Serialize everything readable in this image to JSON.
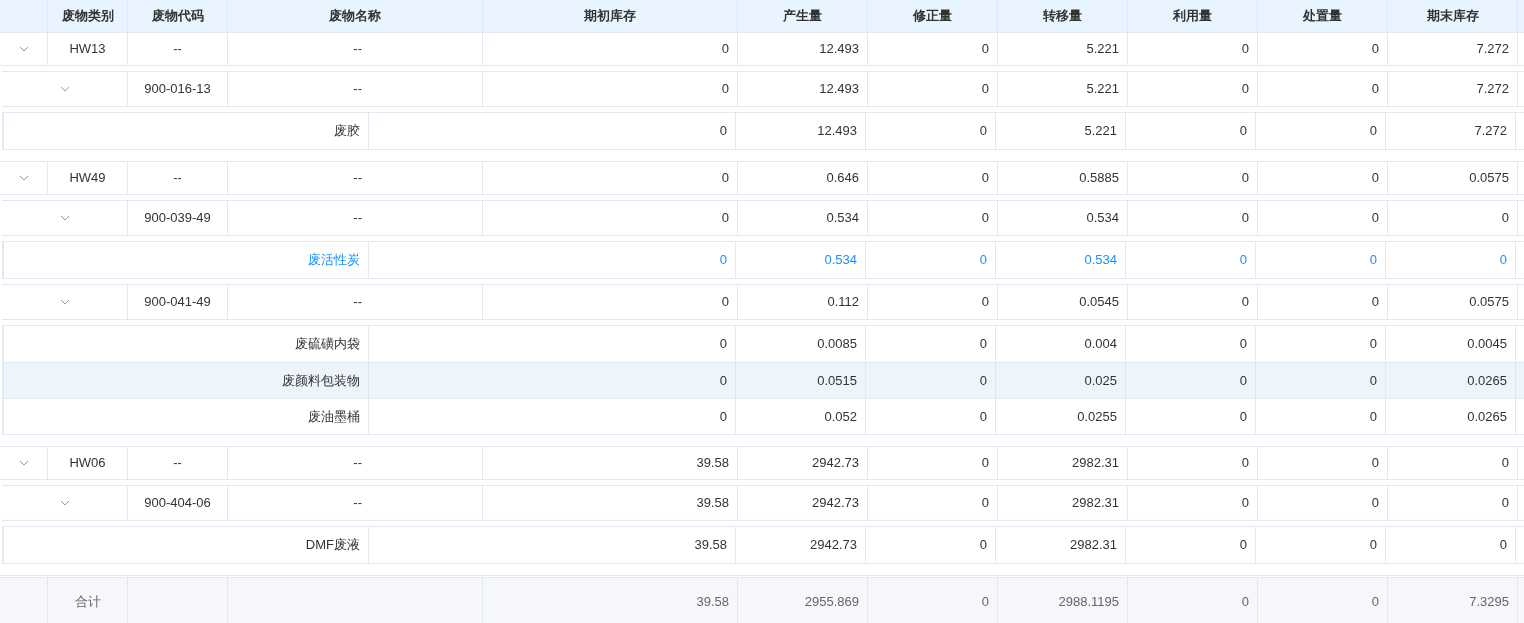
{
  "columns": [
    "废物类别",
    "废物代码",
    "废物名称",
    "期初库存",
    "产生量",
    "修正量",
    "转移量",
    "利用量",
    "处置量",
    "期末库存"
  ],
  "categories": [
    {
      "type": "HW13",
      "code": "--",
      "name": "--",
      "expanded": true,
      "values": [
        "0",
        "12.493",
        "0",
        "5.221",
        "0",
        "0",
        "7.272"
      ],
      "children": [
        {
          "code": "900-016-13",
          "name": "--",
          "expanded": true,
          "values": [
            "0",
            "12.493",
            "0",
            "5.221",
            "0",
            "0",
            "7.272"
          ],
          "children": [
            {
              "name": "废胶",
              "selected": false,
              "hovered": false,
              "values": [
                "0",
                "12.493",
                "0",
                "5.221",
                "0",
                "0",
                "7.272"
              ]
            }
          ]
        }
      ]
    },
    {
      "type": "HW49",
      "code": "--",
      "name": "--",
      "expanded": true,
      "values": [
        "0",
        "0.646",
        "0",
        "0.5885",
        "0",
        "0",
        "0.0575"
      ],
      "children": [
        {
          "code": "900-039-49",
          "name": "--",
          "expanded": true,
          "values": [
            "0",
            "0.534",
            "0",
            "0.534",
            "0",
            "0",
            "0"
          ],
          "children": [
            {
              "name": "废活性炭",
              "selected": true,
              "hovered": false,
              "values": [
                "0",
                "0.534",
                "0",
                "0.534",
                "0",
                "0",
                "0"
              ]
            }
          ]
        },
        {
          "code": "900-041-49",
          "name": "--",
          "expanded": true,
          "values": [
            "0",
            "0.112",
            "0",
            "0.0545",
            "0",
            "0",
            "0.0575"
          ],
          "children": [
            {
              "name": "废硫磺内袋",
              "selected": false,
              "hovered": false,
              "values": [
                "0",
                "0.0085",
                "0",
                "0.004",
                "0",
                "0",
                "0.0045"
              ]
            },
            {
              "name": "废颜料包装物",
              "selected": false,
              "hovered": true,
              "values": [
                "0",
                "0.0515",
                "0",
                "0.025",
                "0",
                "0",
                "0.0265"
              ]
            },
            {
              "name": "废油墨桶",
              "selected": false,
              "hovered": false,
              "values": [
                "0",
                "0.052",
                "0",
                "0.0255",
                "0",
                "0",
                "0.0265"
              ]
            }
          ]
        }
      ]
    },
    {
      "type": "HW06",
      "code": "--",
      "name": "--",
      "expanded": true,
      "values": [
        "39.58",
        "2942.73",
        "0",
        "2982.31",
        "0",
        "0",
        "0"
      ],
      "children": [
        {
          "code": "900-404-06",
          "name": "--",
          "expanded": true,
          "values": [
            "39.58",
            "2942.73",
            "0",
            "2982.31",
            "0",
            "0",
            "0"
          ],
          "children": [
            {
              "name": "DMF废液",
              "selected": false,
              "hovered": false,
              "values": [
                "39.58",
                "2942.73",
                "0",
                "2982.31",
                "0",
                "0",
                "0"
              ]
            }
          ]
        }
      ]
    }
  ],
  "total": {
    "label": "合计",
    "values": [
      "39.58",
      "2955.869",
      "0",
      "2988.1195",
      "0",
      "0",
      "7.3295"
    ]
  }
}
